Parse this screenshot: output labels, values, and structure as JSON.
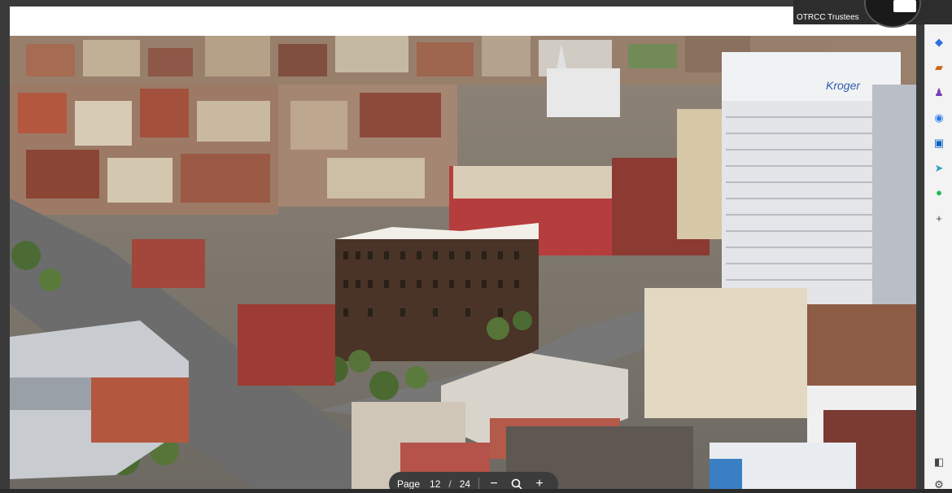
{
  "video_tile": {
    "participant": "OTRCC Trustees"
  },
  "page_nav": {
    "label": "Page",
    "current": "12",
    "separator": "/",
    "total": "24",
    "zoom_out": "−",
    "zoom_in": "+"
  },
  "building_sign": "Kroger",
  "sidebar": {
    "items": [
      {
        "icon": "tag-icon",
        "glyph": "◆",
        "color": "#2f6fde"
      },
      {
        "icon": "briefcase-icon",
        "glyph": "▰",
        "color": "#d0621c"
      },
      {
        "icon": "people-icon",
        "glyph": "♟",
        "color": "#7a3fb3"
      },
      {
        "icon": "copilot-icon",
        "glyph": "◉",
        "color": "#2b7be6"
      },
      {
        "icon": "outlook-icon",
        "glyph": "▣",
        "color": "#0b62c4"
      },
      {
        "icon": "send-icon",
        "glyph": "➤",
        "color": "#2aa5b8"
      },
      {
        "icon": "spotify-icon",
        "glyph": "●",
        "color": "#1db954"
      },
      {
        "icon": "add-icon",
        "glyph": "+",
        "color": "#444444"
      }
    ],
    "bottom": [
      {
        "icon": "sidebar-toggle-icon",
        "glyph": "◧",
        "color": "#444444"
      },
      {
        "icon": "settings-icon",
        "glyph": "⚙",
        "color": "#444444"
      }
    ]
  }
}
